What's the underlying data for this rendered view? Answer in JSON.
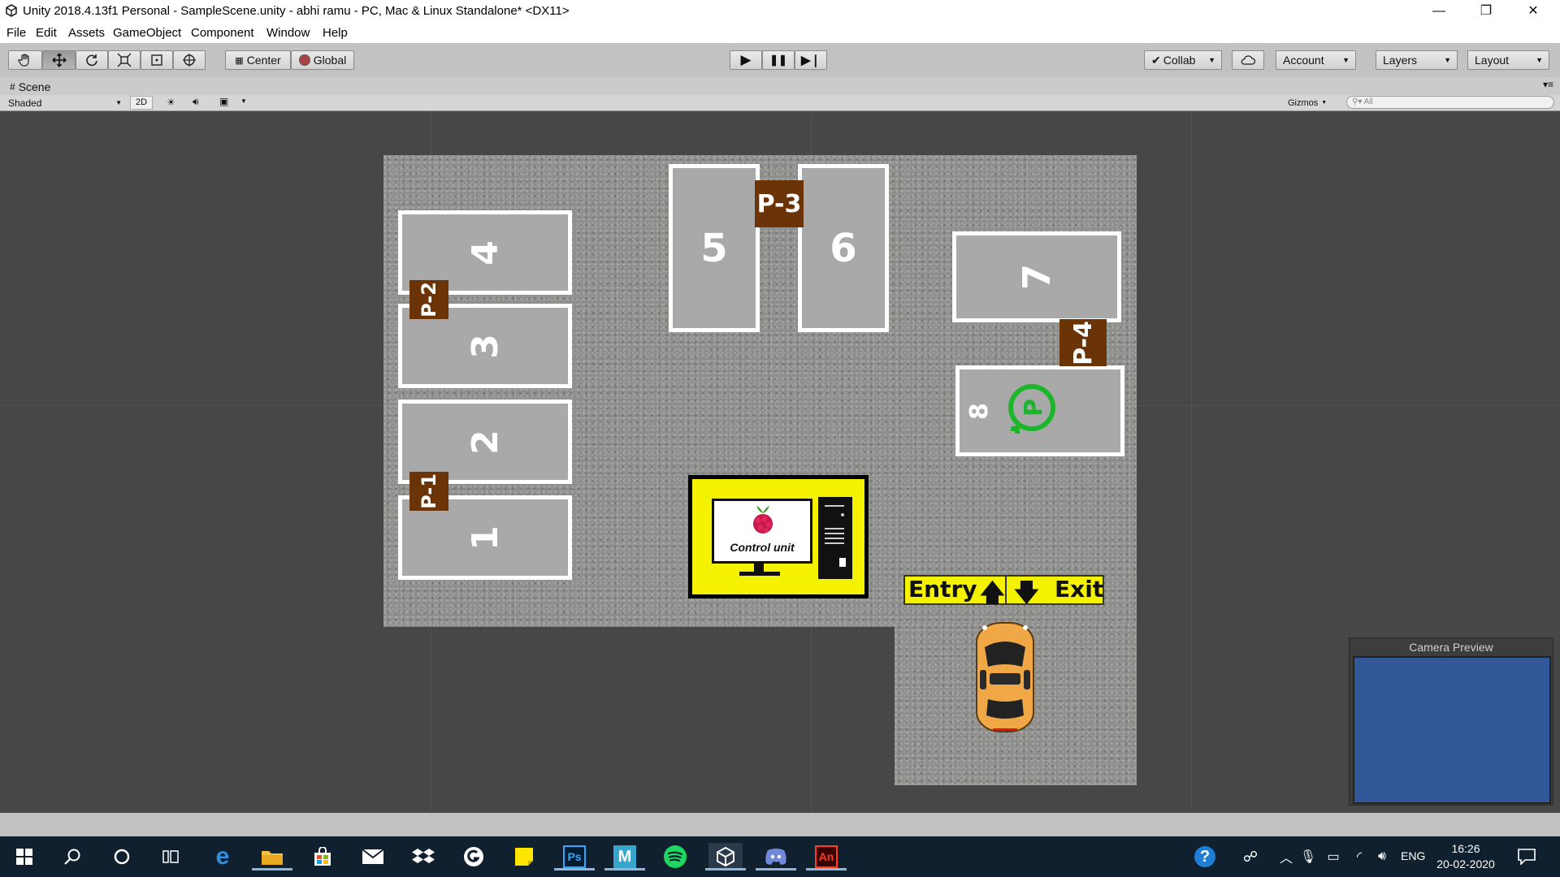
{
  "window": {
    "title": "Unity 2018.4.13f1 Personal - SampleScene.unity - abhi ramu - PC, Mac & Linux Standalone* <DX11>",
    "minimize": "—",
    "restore": "❐",
    "close": "✕"
  },
  "menu": [
    "File",
    "Edit",
    "Assets",
    "GameObject",
    "Component",
    "Window",
    "Help"
  ],
  "toolbar": {
    "tools": [
      "hand-icon",
      "move-icon",
      "rotate-icon",
      "scale-icon",
      "rect-icon",
      "transform-icon"
    ],
    "pivot": "Center",
    "space": "Global",
    "play": "▶",
    "pause": "❚❚",
    "step": "▶❘",
    "collab": "Collab",
    "account": "Account",
    "layers": "Layers",
    "layout": "Layout"
  },
  "scene_tab": {
    "label": "Scene"
  },
  "scene_options": {
    "shading": "Shaded",
    "mode_2d": "2D",
    "gizmos": "Gizmos",
    "search_placeholder": "All"
  },
  "parking": {
    "slots": [
      "1",
      "2",
      "3",
      "4",
      "5",
      "6",
      "7",
      "8"
    ],
    "labels": [
      "P-1",
      "P-2",
      "P-3",
      "P-4"
    ],
    "control_unit": "Control unit",
    "entry": "Entry",
    "exit": "Exit",
    "charger_symbol": "P"
  },
  "camera_preview": {
    "title": "Camera Preview",
    "color": "#33589a"
  },
  "taskbar": {
    "language": "ENG",
    "time": "16:26",
    "date": "20-02-2020",
    "apps": [
      "edge-icon",
      "file-explorer-icon",
      "store-icon",
      "mail-icon",
      "dropbox-icon",
      "logitech-icon",
      "sticky-notes-icon",
      "photoshop-icon",
      "maya-icon",
      "spotify-icon",
      "unity-icon",
      "discord-icon",
      "animate-icon"
    ],
    "photoshop": "Ps",
    "maya": "M",
    "animate": "An"
  },
  "colors": {
    "brown_label": "#6b3406",
    "yellow": "#f5f200",
    "charger_green": "#1bb62a",
    "taskbar": "#10202e"
  }
}
